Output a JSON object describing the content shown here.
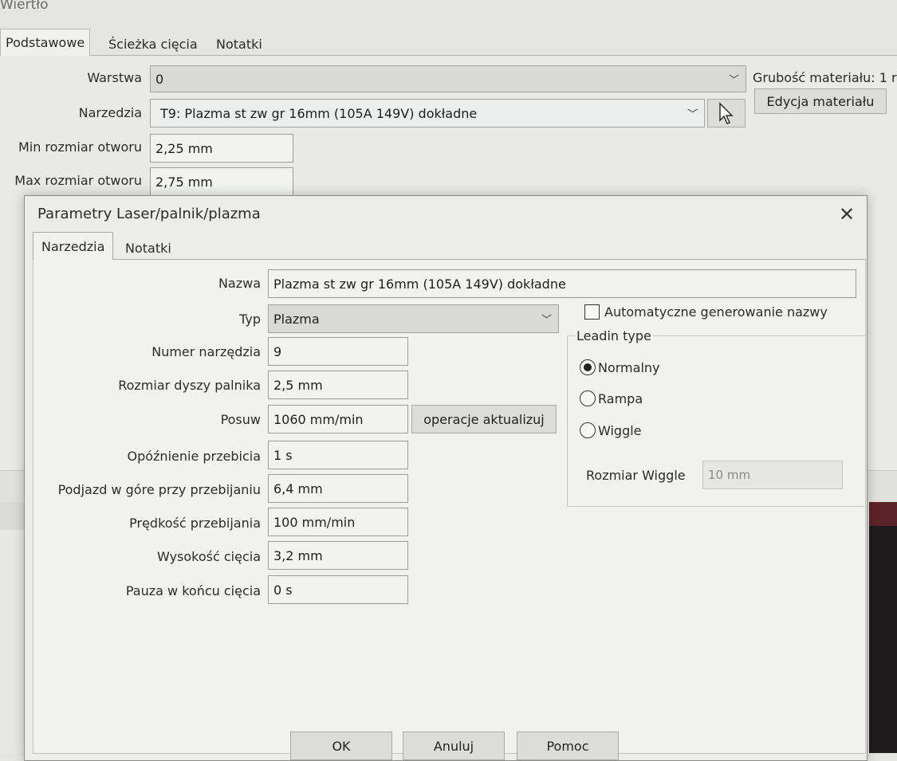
{
  "background_window": {
    "title": "Wiertło",
    "tabs": [
      "Podstawowe",
      "Ścieżka cięcia",
      "Notatki"
    ],
    "warstwa_label": "Warstwa",
    "warstwa_value": "0",
    "grubosc_label": "Grubość materiału: 1 r",
    "narzedzia_label": "Narzedzia",
    "narzedzia_value": "T9: Plazma st zw gr 16mm (105A 149V) dokładne",
    "edycja_button": "Edycja materiału",
    "min_label": "Min rozmiar otworu",
    "min_value": "2,25 mm",
    "max_label": "Max rozmiar otworu",
    "max_value": "2,75 mm"
  },
  "dialog": {
    "title": "Parametry Laser/palnik/plazma",
    "tabs": [
      "Narzedzia",
      "Notatki"
    ],
    "nazwa_label": "Nazwa",
    "nazwa_value": "Plazma st zw gr 16mm (105A 149V) dokładne",
    "typ_label": "Typ",
    "typ_value": "Plazma",
    "auto_name_label": "Automatyczne generowanie nazwy",
    "numer_label": "Numer narzędzia",
    "numer_value": "9",
    "dysza_label": "Rozmiar dyszy palnika",
    "dysza_value": "2,5 mm",
    "posuw_label": "Posuw",
    "posuw_value": "1060 mm/min",
    "update_button": "operacje aktualizuj",
    "opoznienie_label": "Opóźnienie przebicia",
    "opoznienie_value": "1 s",
    "podjazd_label": "Podjazd w góre przy przebijaniu",
    "podjazd_value": "6,4 mm",
    "predkosc_label": "Prędkość przebijania",
    "predkosc_value": "100 mm/min",
    "wysokosc_label": "Wysokość cięcia",
    "wysokosc_value": "3,2 mm",
    "pauza_label": "Pauza w końcu cięcia",
    "pauza_value": "0 s",
    "leadin": {
      "title": "Leadin type",
      "options": [
        "Normalny",
        "Rampa",
        "Wiggle"
      ],
      "selected": "Normalny",
      "wiggle_label": "Rozmiar Wiggle",
      "wiggle_value": "10 mm"
    },
    "buttons": {
      "ok": "OK",
      "cancel": "Anuluj",
      "help": "Pomoc"
    }
  },
  "icons": {
    "chevron": "chevron-down-icon",
    "close": "close-icon",
    "cursor": "mouse-pointer-icon"
  }
}
